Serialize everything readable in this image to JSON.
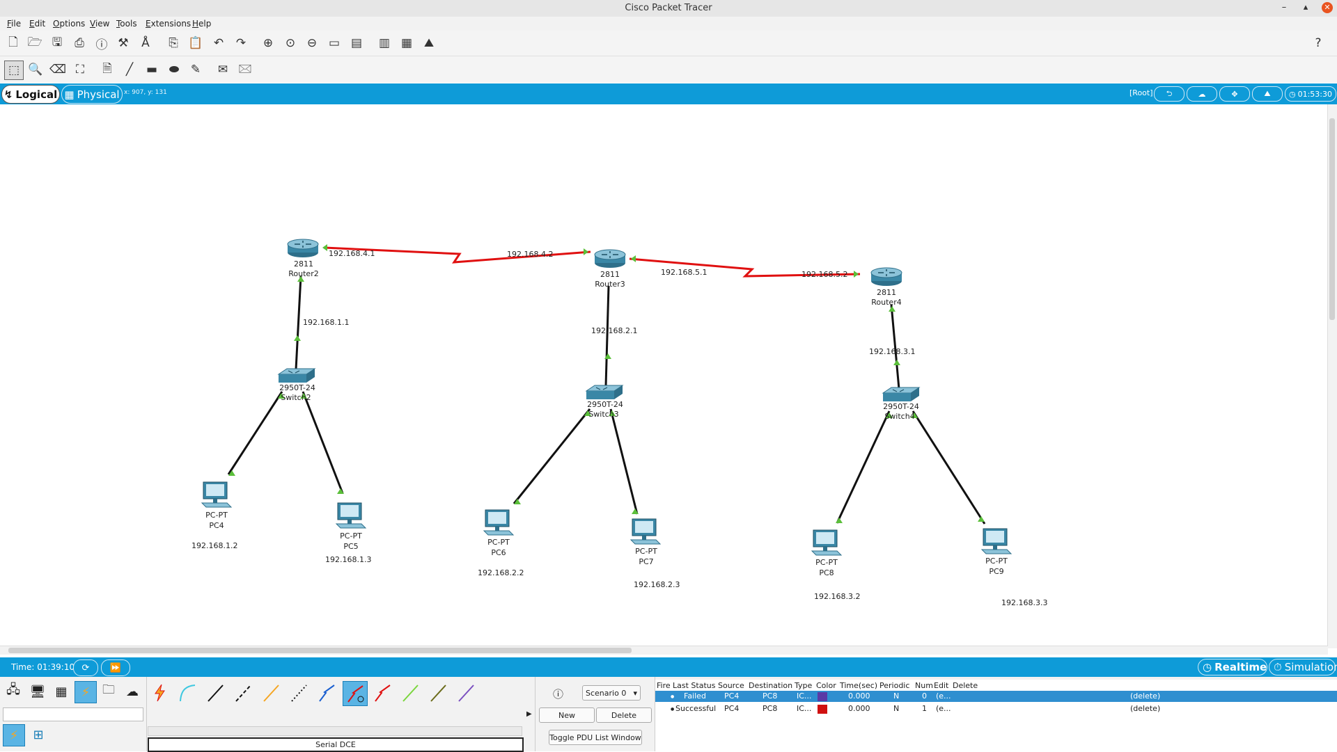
{
  "window": {
    "title": "Cisco Packet Tracer",
    "minimize": "–",
    "maximize": "▴",
    "close": "✕"
  },
  "menu": [
    "File",
    "Edit",
    "Options",
    "View",
    "Tools",
    "Extensions",
    "Help"
  ],
  "help_icon": "?",
  "mode_bar": {
    "logical": "Logical",
    "physical": "Physical",
    "coords": "x: 907, y: 131",
    "root": "[Root]",
    "clock": "01:53:30"
  },
  "topology": {
    "routers": [
      {
        "model": "2811",
        "name": "Router2"
      },
      {
        "model": "2811",
        "name": "Router3"
      },
      {
        "model": "2811",
        "name": "Router4"
      }
    ],
    "switches": [
      {
        "model": "2950T-24",
        "name": "Switch2"
      },
      {
        "model": "2950T-24",
        "name": "Switch3"
      },
      {
        "model": "2950T-24",
        "name": "Switch4"
      }
    ],
    "pcs": [
      {
        "model": "PC-PT",
        "name": "PC4",
        "ip": "192.168.1.2"
      },
      {
        "model": "PC-PT",
        "name": "PC5",
        "ip": "192.168.1.3"
      },
      {
        "model": "PC-PT",
        "name": "PC6",
        "ip": "192.168.2.2"
      },
      {
        "model": "PC-PT",
        "name": "PC7",
        "ip": "192.168.2.3"
      },
      {
        "model": "PC-PT",
        "name": "PC8",
        "ip": "192.168.3.2"
      },
      {
        "model": "PC-PT",
        "name": "PC9",
        "ip": "192.168.3.3"
      }
    ],
    "interface_labels": {
      "r2_serial": "192.168.4.1",
      "r3_serial_left": "192.168.4.2",
      "r3_serial_right": "192.168.5.1",
      "r4_serial": "192.168.5.2",
      "r2_lan": "192.168.1.1",
      "r3_lan": "192.168.2.1",
      "r4_lan": "192.168.3.1"
    },
    "colors": {
      "serial_link": "#e01010",
      "ethernet_link": "#111111",
      "link_up": "#5bbf3a"
    }
  },
  "sim_bar": {
    "time": "Time: 01:39:10",
    "realtime": "Realtime",
    "simulation": "Simulation"
  },
  "bottom_panel": {
    "selected_connection": "Serial DCE",
    "scenario": "Scenario 0",
    "new_label": "New",
    "delete_label": "Delete",
    "toggle_label": "Toggle PDU List Window",
    "pdu_headers": [
      "Fire",
      "Last Status",
      "Source",
      "Destination",
      "Type",
      "Color",
      "Time(sec)",
      "Periodic",
      "Num",
      "Edit",
      "Delete"
    ],
    "pdu_rows": [
      {
        "fire": "●",
        "status": "Failed",
        "source": "PC4",
        "destination": "PC8",
        "type": "IC...",
        "color": "#5a3aa6",
        "time": "0.000",
        "periodic": "N",
        "num": "0",
        "edit": "(e...",
        "delete": "(delete)"
      },
      {
        "fire": "●",
        "status": "Successful",
        "source": "PC4",
        "destination": "PC8",
        "type": "IC...",
        "color": "#d01010",
        "time": "0.000",
        "periodic": "N",
        "num": "1",
        "edit": "(e...",
        "delete": "(delete)"
      }
    ]
  }
}
